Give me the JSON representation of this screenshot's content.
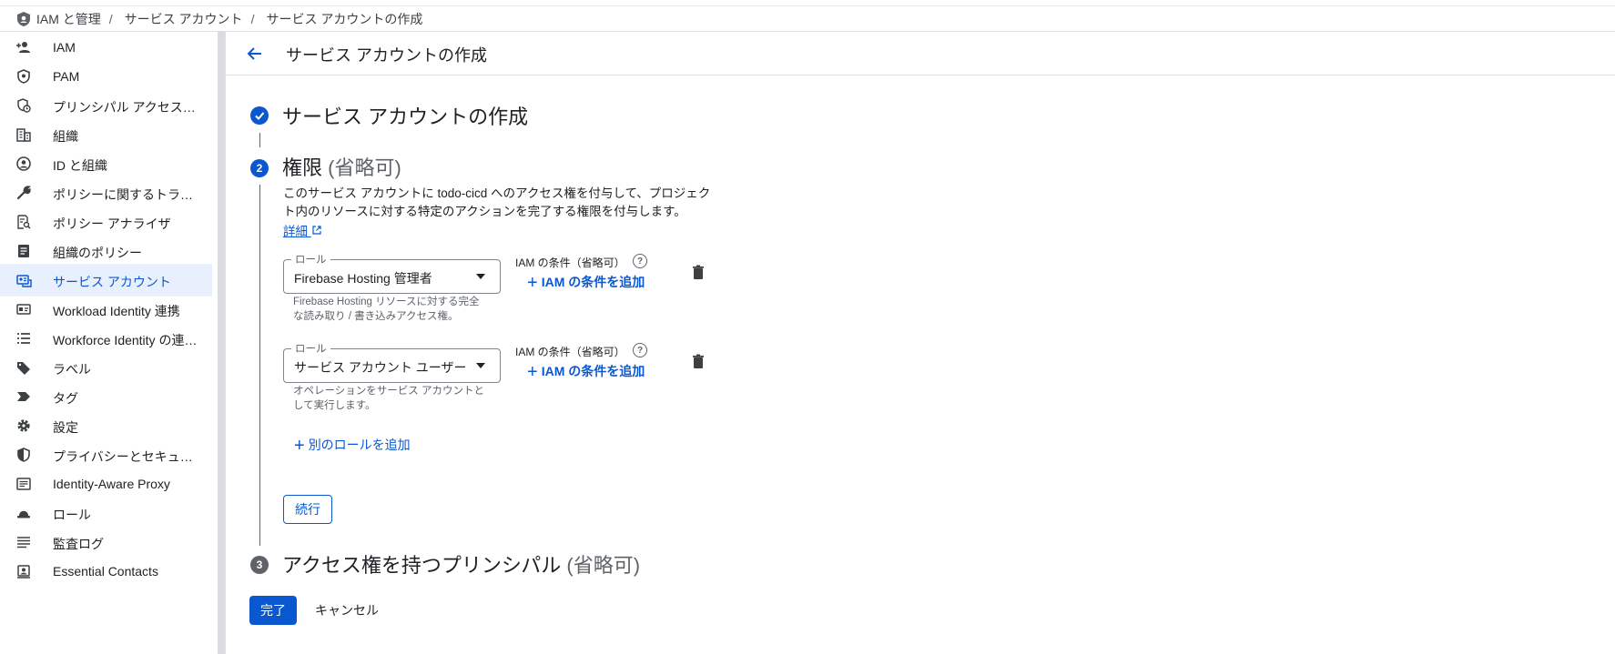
{
  "breadcrumb": {
    "items": [
      "IAM と管理",
      "サービス アカウント",
      "サービス アカウントの作成"
    ]
  },
  "sidebar": {
    "items": [
      {
        "label": "IAM",
        "icon": "person-add-icon"
      },
      {
        "label": "PAM",
        "icon": "shield-icon"
      },
      {
        "label": "プリンシパル アクセス…",
        "icon": "shield-clock-icon"
      },
      {
        "label": "組織",
        "icon": "building-icon"
      },
      {
        "label": "ID と組織",
        "icon": "account-circle-icon"
      },
      {
        "label": "ポリシーに関するトラ…",
        "icon": "wrench-icon"
      },
      {
        "label": "ポリシー アナライザ",
        "icon": "doc-search-icon"
      },
      {
        "label": "組織のポリシー",
        "icon": "list-doc-icon"
      },
      {
        "label": "サービス アカウント",
        "icon": "service-account-icon",
        "active": true
      },
      {
        "label": "Workload Identity 連携",
        "icon": "id-card-icon"
      },
      {
        "label": "Workforce Identity の連…",
        "icon": "list-icon"
      },
      {
        "label": "ラベル",
        "icon": "tag-icon"
      },
      {
        "label": "タグ",
        "icon": "chevron-tag-icon"
      },
      {
        "label": "設定",
        "icon": "gear-icon"
      },
      {
        "label": "プライバシーとセキュ…",
        "icon": "shield-half-icon"
      },
      {
        "label": "Identity-Aware Proxy",
        "icon": "proxy-icon"
      },
      {
        "label": "ロール",
        "icon": "hat-icon"
      },
      {
        "label": "監査ログ",
        "icon": "lines-icon"
      },
      {
        "label": "Essential Contacts",
        "icon": "contact-icon"
      }
    ]
  },
  "header": {
    "title": "サービス アカウントの作成"
  },
  "steps": {
    "step1": {
      "title": "サービス アカウントの作成",
      "state": "completed"
    },
    "step2": {
      "number": "2",
      "title": "権限",
      "optional": "(省略可)",
      "description": "このサービス アカウントに todo-cicd へのアクセス権を付与して、プロジェクト内のリソースに対する特定のアクションを完了する権限を付与します。",
      "link": "詳細"
    },
    "step3": {
      "number": "3",
      "title": "アクセス権を持つプリンシパル",
      "optional": "(省略可)"
    }
  },
  "roles": [
    {
      "legend": "ロール",
      "value": "Firebase Hosting 管理者",
      "hint": "Firebase Hosting リソースに対する完全な読み取り / 書き込みアクセス権。",
      "condition_label": "IAM の条件（省略可）",
      "add_condition": "IAM の条件を追加"
    },
    {
      "legend": "ロール",
      "value": "サービス アカウント ユーザー",
      "hint": "オペレーションをサービス アカウントとして実行します。",
      "condition_label": "IAM の条件（省略可）",
      "add_condition": "IAM の条件を追加"
    }
  ],
  "actions": {
    "add_role": "別のロールを追加",
    "continue": "続行",
    "done": "完了",
    "cancel": "キャンセル"
  },
  "colors": {
    "accent": "#0b57d0",
    "active_bg": "#e8f0fe",
    "step_inactive": "#5f6368"
  }
}
